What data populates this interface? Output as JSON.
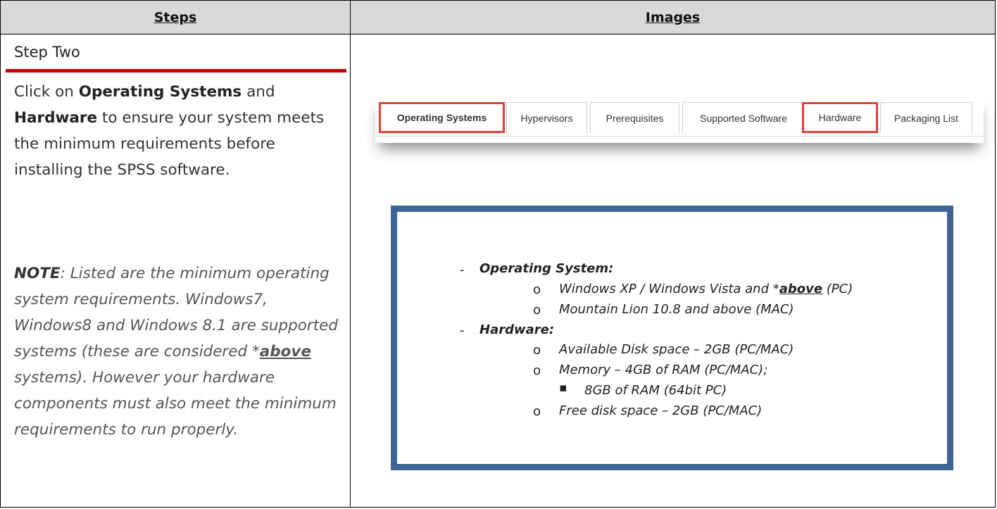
{
  "header": {
    "steps": "Steps",
    "images": "Images"
  },
  "step": {
    "title": "Step Two",
    "desc_pre": "Click on ",
    "desc_b1": "Operating Systems",
    "desc_mid": " and ",
    "desc_b2": "Hardware",
    "desc_post": " to ensure your system meets the minimum requirements before installing the SPSS software.",
    "note_label": "NOTE",
    "note_text": ": Listed are the minimum operating system requirements. Windows7, Windows8 and Windows 8.1 are supported systems (these are considered *",
    "note_above": "above",
    "note_tail": " systems).  However your hardware components must also meet the minimum requirements to run properly."
  },
  "tabs": [
    {
      "label": "Operating Systems",
      "highlighted": true
    },
    {
      "label": "Hypervisors",
      "highlighted": false
    },
    {
      "label": "Prerequisites",
      "highlighted": false
    },
    {
      "label": "Supported Software",
      "highlighted": false
    },
    {
      "label": "Hardware",
      "highlighted": true
    },
    {
      "label": "Packaging List",
      "highlighted": false
    }
  ],
  "requirements": {
    "os_heading": "Operating System:",
    "os_items": {
      "windows_pre": "Windows XP / Windows Vista and *",
      "windows_above": "above",
      "windows_post": " (PC)",
      "mac": "Mountain Lion 10.8 and above (MAC)"
    },
    "hw_heading": "Hardware:",
    "hw_items": {
      "disk": "Available Disk space – 2GB (PC/MAC)",
      "memory": "Memory – 4GB of RAM (PC/MAC);",
      "memory_sub": "8GB of RAM (64bit PC)",
      "free": "Free disk space – 2GB (PC/MAC)"
    },
    "dash": "-",
    "bullet": "o",
    "square": "▪"
  },
  "colors": {
    "header_bg": "#d9d9d9",
    "red_rule": "#c00000",
    "box_border": "#3e6496",
    "tab_highlight": "#e0413a"
  }
}
